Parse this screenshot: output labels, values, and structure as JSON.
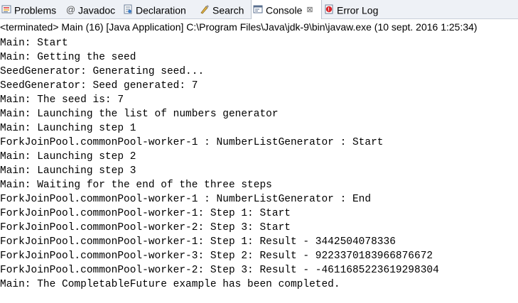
{
  "tabs": [
    {
      "name": "problems",
      "label": "Problems",
      "icon": "problems-icon"
    },
    {
      "name": "javadoc",
      "label": "Javadoc",
      "icon": "javadoc-icon"
    },
    {
      "name": "declaration",
      "label": "Declaration",
      "icon": "declaration-icon"
    },
    {
      "name": "search",
      "label": "Search",
      "icon": "search-icon"
    },
    {
      "name": "console",
      "label": "Console",
      "icon": "console-icon",
      "active": true,
      "close_glyph": "⊠"
    },
    {
      "name": "error-log",
      "label": "Error Log",
      "icon": "error-log-icon"
    }
  ],
  "status_line": "<terminated> Main (16) [Java Application] C:\\Program Files\\Java\\jdk-9\\bin\\javaw.exe (10 sept. 2016 1:25:34)",
  "console_lines": [
    "Main: Start",
    "Main: Getting the seed",
    "SeedGenerator: Generating seed...",
    "SeedGenerator: Seed generated: 7",
    "Main: The seed is: 7",
    "Main: Launching the list of numbers generator",
    "Main: Launching step 1",
    "ForkJoinPool.commonPool-worker-1 : NumberListGenerator : Start",
    "Main: Launching step 2",
    "Main: Launching step 3",
    "Main: Waiting for the end of the three steps",
    "ForkJoinPool.commonPool-worker-1 : NumberListGenerator : End",
    "ForkJoinPool.commonPool-worker-1: Step 1: Start",
    "ForkJoinPool.commonPool-worker-2: Step 3: Start",
    "ForkJoinPool.commonPool-worker-1: Step 1: Result - 3442504078336",
    "ForkJoinPool.commonPool-worker-3: Step 2: Result - 9223370183966876672",
    "ForkJoinPool.commonPool-worker-2: Step 3: Result - -4611685223619298304",
    "Main: The CompletableFuture example has been completed."
  ],
  "colors": {
    "tabbar_bg": "#eef1f6",
    "active_tab_bg": "#ffffff",
    "text": "#000000",
    "error_red": "#d9262b"
  }
}
